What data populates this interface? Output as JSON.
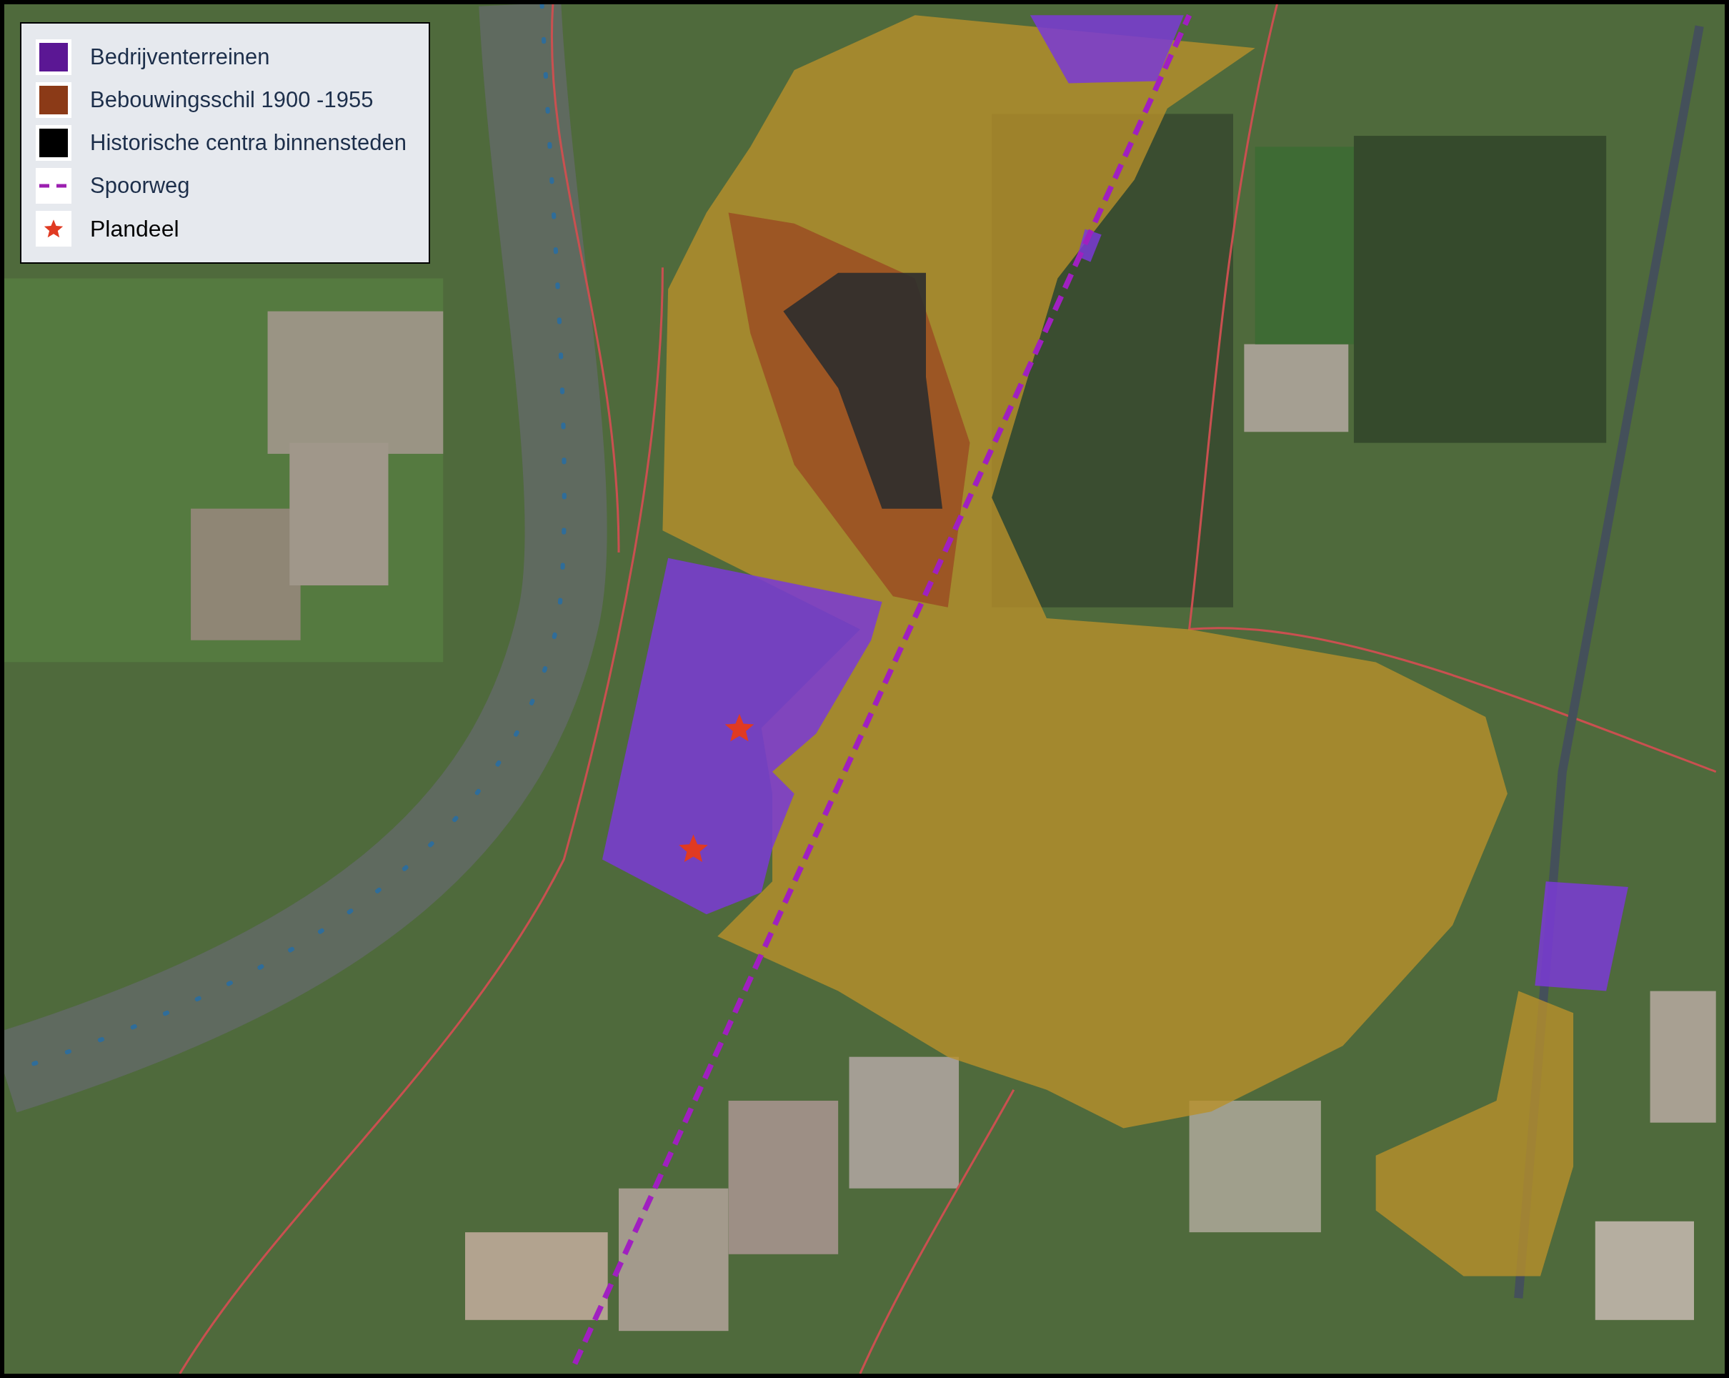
{
  "legend": {
    "items": [
      {
        "kind": "swatch",
        "label": "Bedrijventerreinen",
        "color": "#5b1794"
      },
      {
        "kind": "swatch",
        "label": "Bebouwingsschil 1900 -1955",
        "color": "#8b3a17"
      },
      {
        "kind": "swatch",
        "label": "Historische centra binnensteden",
        "color": "#000000"
      },
      {
        "kind": "dash",
        "label": "Spoorweg",
        "color": "#9b1fb0"
      },
      {
        "kind": "star",
        "label": "Plandeel",
        "color": "#e03a22"
      }
    ]
  }
}
